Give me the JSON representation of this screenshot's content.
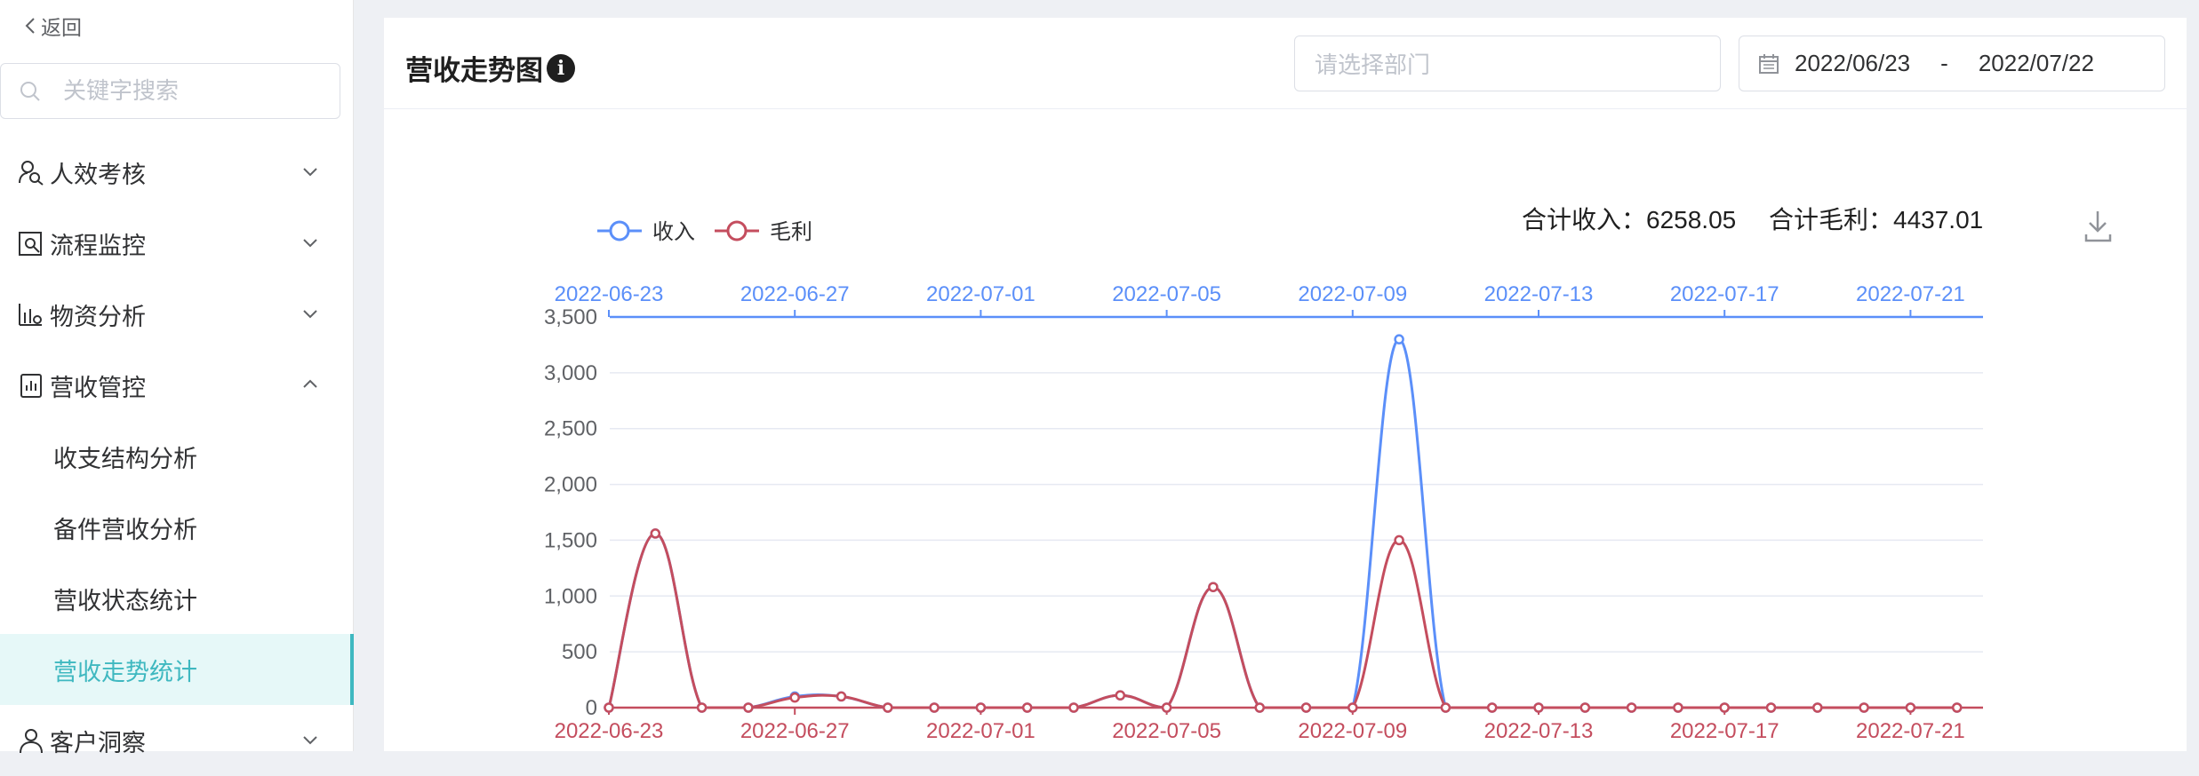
{
  "sidebar": {
    "back_label": "返回",
    "search_placeholder": "关键字搜索",
    "menu": [
      {
        "label": "人效考核",
        "icon": "people-search-icon",
        "expanded": false
      },
      {
        "label": "流程监控",
        "icon": "process-monitor-icon",
        "expanded": false
      },
      {
        "label": "物资分析",
        "icon": "bar-analysis-icon",
        "expanded": false
      },
      {
        "label": "营收管控",
        "icon": "revenue-report-icon",
        "expanded": true
      },
      {
        "label": "客户洞察",
        "icon": "customer-icon",
        "expanded": false
      }
    ],
    "submenu": [
      {
        "label": "收支结构分析",
        "active": false
      },
      {
        "label": "备件营收分析",
        "active": false
      },
      {
        "label": "营收状态统计",
        "active": false
      },
      {
        "label": "营收走势统计",
        "active": true
      }
    ]
  },
  "card": {
    "title": "营收走势图",
    "dept_placeholder": "请选择部门",
    "date_start": "2022/06/23",
    "date_sep": "-",
    "date_end": "2022/07/22"
  },
  "colors": {
    "income": "#5b8ff9",
    "profit": "#c44d5e",
    "accent": "#3fb8c0"
  },
  "chart_data": {
    "type": "line",
    "legend": [
      "收入",
      "毛利"
    ],
    "legend_position": "top-left",
    "summary": {
      "income_label": "合计收入：",
      "income_total": "6258.05",
      "profit_label": "合计毛利：",
      "profit_total": "4437.01"
    },
    "x": [
      "2022-06-23",
      "2022-06-24",
      "2022-06-25",
      "2022-06-26",
      "2022-06-27",
      "2022-06-28",
      "2022-06-29",
      "2022-06-30",
      "2022-07-01",
      "2022-07-02",
      "2022-07-03",
      "2022-07-04",
      "2022-07-05",
      "2022-07-06",
      "2022-07-07",
      "2022-07-08",
      "2022-07-09",
      "2022-07-10",
      "2022-07-11",
      "2022-07-12",
      "2022-07-13",
      "2022-07-14",
      "2022-07-15",
      "2022-07-16",
      "2022-07-17",
      "2022-07-18",
      "2022-07-19",
      "2022-07-20",
      "2022-07-21",
      "2022-07-22"
    ],
    "x_tick_labels": [
      "2022-06-23",
      "2022-06-27",
      "2022-07-01",
      "2022-07-05",
      "2022-07-09",
      "2022-07-13",
      "2022-07-17",
      "2022-07-21"
    ],
    "series": [
      {
        "name": "收入",
        "values": [
          0,
          1560,
          0,
          0,
          100,
          100,
          0,
          0,
          0,
          0,
          0,
          110,
          0,
          1080,
          0,
          0,
          0,
          3300,
          0,
          0,
          0,
          0,
          0,
          0,
          0,
          0,
          0,
          0,
          0,
          0
        ]
      },
      {
        "name": "毛利",
        "values": [
          0,
          1560,
          0,
          0,
          90,
          100,
          0,
          0,
          0,
          0,
          0,
          110,
          0,
          1080,
          0,
          0,
          0,
          1500,
          0,
          0,
          0,
          0,
          0,
          0,
          0,
          0,
          0,
          0,
          0,
          0
        ]
      }
    ],
    "y_ticks": [
      "0",
      "500",
      "1,000",
      "1,500",
      "2,000",
      "2,500",
      "3,000",
      "3,500"
    ],
    "ylim": [
      0,
      3500
    ],
    "grid": true
  }
}
